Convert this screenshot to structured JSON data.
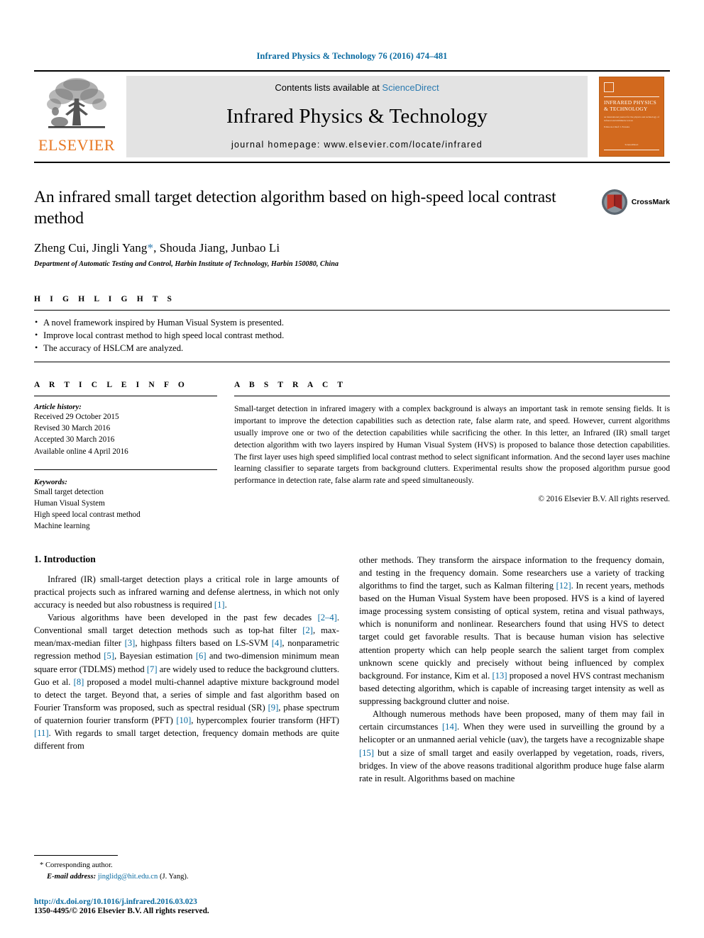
{
  "running_head": "Infrared Physics & Technology 76 (2016) 474–481",
  "masthead": {
    "publisher_name": "ELSEVIER",
    "contents_prefix": "Contents lists available at ",
    "contents_link": "ScienceDirect",
    "journal_name": "Infrared Physics & Technology",
    "homepage": "journal homepage: www.elsevier.com/locate/infrared",
    "cover_title_line1": "INFRARED PHYSICS",
    "cover_title_line2": "& TECHNOLOGY",
    "cover_sub": "an international journal for the physics and technology of infrared and millimetre waves",
    "cover_editor": "Editor-in-Chief: I. Ferreira",
    "cover_bottom": "Available online at",
    "cover_bottom2": "ScienceDirect"
  },
  "title": "An infrared small target detection algorithm based on high-speed local contrast method",
  "authors_pre": "Zheng Cui, Jingli Yang",
  "authors_star": "*",
  "authors_post": ", Shouda Jiang, Junbao Li",
  "affiliation": "Department of Automatic Testing and Control, Harbin Institute of Technology, Harbin 150080, China",
  "crossmark_label": "CrossMark",
  "highlights": {
    "label": "H I G H L I G H T S",
    "items": [
      "A novel framework inspired by Human Visual System is presented.",
      "Improve local contrast method to high speed local contrast method.",
      "The accuracy of HSLCM are analyzed."
    ]
  },
  "article_info": {
    "label": "A R T I C L E    I N F O",
    "history_label": "Article history:",
    "history": [
      "Received 29 October 2015",
      "Revised 30 March 2016",
      "Accepted 30 March 2016",
      "Available online 4 April 2016"
    ],
    "keywords_label": "Keywords:",
    "keywords": [
      "Small target detection",
      "Human Visual System",
      "High speed local contrast method",
      "Machine learning"
    ]
  },
  "abstract": {
    "label": "A B S T R A C T",
    "text": "Small-target detection in infrared imagery with a complex background is always an important task in remote sensing fields. It is important to improve the detection capabilities such as detection rate, false alarm rate, and speed. However, current algorithms usually improve one or two of the detection capabilities while sacrificing the other. In this letter, an Infrared (IR) small target detection algorithm with two layers inspired by Human Visual System (HVS) is proposed to balance those detection capabilities. The first layer uses high speed simplified local contrast method to select significant information. And the second layer uses machine learning classifier to separate targets from background clutters. Experimental results show the proposed algorithm pursue good performance in detection rate, false alarm rate and speed simultaneously.",
    "copyright": "© 2016 Elsevier B.V. All rights reserved."
  },
  "introduction": {
    "heading": "1. Introduction",
    "left_para1_a": "Infrared (IR) small-target detection plays a critical role in large amounts of practical projects such as infrared warning and defense alertness, in which not only accuracy is needed but also robustness is required ",
    "left_para1_ref": "[1]",
    "left_para1_b": ".",
    "left_para2_seq": [
      {
        "t": "Various algorithms have been developed in the past few decades "
      },
      {
        "t": "[2–4]",
        "r": true
      },
      {
        "t": ". Conventional small target detection methods such as top-hat filter "
      },
      {
        "t": "[2]",
        "r": true
      },
      {
        "t": ", max-mean/max-median filter "
      },
      {
        "t": "[3]",
        "r": true
      },
      {
        "t": ", highpass filters based on LS-SVM "
      },
      {
        "t": "[4]",
        "r": true
      },
      {
        "t": ", nonparametric regression method "
      },
      {
        "t": "[5]",
        "r": true
      },
      {
        "t": ", Bayesian estimation "
      },
      {
        "t": "[6]",
        "r": true
      },
      {
        "t": " and two-dimension minimum mean square error (TDLMS) method "
      },
      {
        "t": "[7]",
        "r": true
      },
      {
        "t": " are widely used to reduce the background clutters. Guo et al. "
      },
      {
        "t": "[8]",
        "r": true
      },
      {
        "t": " proposed a model multi-channel adaptive mixture background model to detect the target. Beyond that, a series of simple and fast algorithm based on Fourier Transform was proposed, such as spectral residual (SR) "
      },
      {
        "t": "[9]",
        "r": true
      },
      {
        "t": ", phase spectrum of quaternion fourier transform (PFT) "
      },
      {
        "t": "[10]",
        "r": true
      },
      {
        "t": ", hypercomplex fourier transform (HFT) "
      },
      {
        "t": "[11]",
        "r": true
      },
      {
        "t": ". With regards to small target detection, frequency domain methods are quite different from"
      }
    ],
    "right_para1_seq": [
      {
        "t": "other methods. They transform the airspace information to the frequency domain, and testing in the frequency domain. Some researchers use a variety of tracking algorithms to find the target, such as Kalman filtering "
      },
      {
        "t": "[12]",
        "r": true
      },
      {
        "t": ". In recent years, methods based on the Human Visual System have been proposed. HVS is a kind of layered image processing system consisting of optical system, retina and visual pathways, which is nonuniform and nonlinear. Researchers found that using HVS to detect target could get favorable results. That is because human vision has selective attention property which can help people search the salient target from complex unknown scene quickly and precisely without being influenced by complex background. For instance, Kim et al. "
      },
      {
        "t": "[13]",
        "r": true
      },
      {
        "t": " proposed a novel HVS contrast mechanism based detecting algorithm, which is capable of increasing target intensity as well as suppressing background clutter and noise."
      }
    ],
    "right_para2_seq": [
      {
        "t": "Although numerous methods have been proposed, many of them may fail in certain circumstances "
      },
      {
        "t": "[14]",
        "r": true
      },
      {
        "t": ". When they were used in surveilling the ground by a helicopter or an unmanned aerial vehicle (uav), the targets have a recognizable shape "
      },
      {
        "t": "[15]",
        "r": true
      },
      {
        "t": " but a size of small target and easily overlapped by vegetation, roads, rivers, bridges. In view of the above reasons traditional algorithm produce huge false alarm rate in result. Algorithms based on machine"
      }
    ]
  },
  "footnote": {
    "corresponding": "Corresponding author.",
    "email_label": "E-mail address:",
    "email": "jinglidg@hit.edu.cn",
    "email_owner": "(J. Yang)."
  },
  "page_footer": {
    "doi": "http://dx.doi.org/10.1016/j.infrared.2016.03.023",
    "issn": "1350-4495/© 2016 Elsevier B.V. All rights reserved."
  },
  "colors": {
    "link_blue": "#0a6ba1",
    "elsevier_orange": "#E87722",
    "cover_orange": "#D2691E"
  }
}
